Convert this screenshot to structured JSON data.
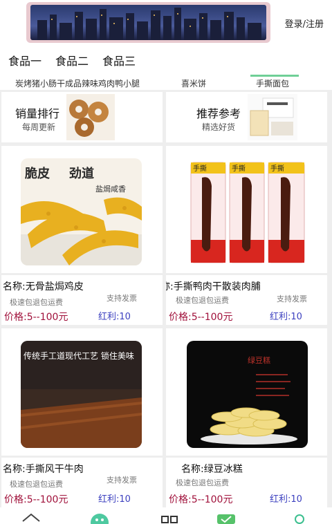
{
  "header": {
    "login_register": "登录/注册"
  },
  "tabs": [
    "食品一",
    "食品二",
    "食品三"
  ],
  "ticker": [
    "炭烤猪小肠干成品辣味鸡肉鸭小腿",
    "喜米饼",
    "手撕面包"
  ],
  "promos": [
    {
      "title": "销量排行",
      "subtitle": "每周更新"
    },
    {
      "title": "推荐参考",
      "subtitle": "精选好货"
    }
  ],
  "products": [
    {
      "name": "名称:无骨盐焗鸡皮",
      "shipping": "极速包退包运费",
      "support": "支持发票",
      "price": "价格:5--100元",
      "bonus": "红利:10",
      "image_text": [
        "脆皮",
        "劲道",
        "盐焗咸香"
      ]
    },
    {
      "name": "名称:手撕鸭肉干散装肉脯",
      "shipping": "极速包退包运费",
      "support": "支持发票",
      "price": "价格:5--100元",
      "bonus": "红利:10",
      "image_text": [
        "手撕",
        "手撕",
        "手撕"
      ]
    },
    {
      "name": "名称:手撕风干牛肉",
      "shipping": "极速包退包运费",
      "support": "支持发票",
      "price": "价格:5--100元",
      "bonus": "红利:10",
      "image_text": [
        "传统手工道现代工艺 锁住美味"
      ]
    },
    {
      "name": "名称:绿豆冰糕",
      "shipping": "极速包退包运费",
      "support": "",
      "price": "价格:5--100元",
      "bonus": "红利:10",
      "image_text": [
        "绿豆糕"
      ]
    }
  ],
  "colors": {
    "price": "#a0103a",
    "bonus": "#3b3fbf",
    "accent_green": "#6fcf97"
  },
  "bottom_nav": [
    "home-icon",
    "face-icon",
    "grid-icon",
    "cart-icon",
    "user-icon"
  ]
}
